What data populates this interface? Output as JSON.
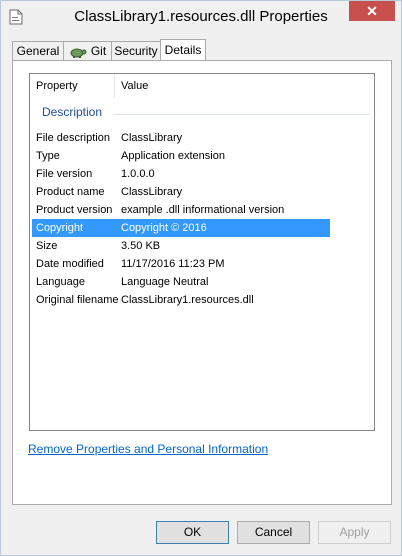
{
  "window": {
    "title": "ClassLibrary1.resources.dll Properties",
    "close_label": "✕"
  },
  "tabs": [
    {
      "label": "General"
    },
    {
      "label": "Git"
    },
    {
      "label": "Security"
    },
    {
      "label": "Details"
    }
  ],
  "details": {
    "columns": {
      "property": "Property",
      "value": "Value"
    },
    "group_label": "Description",
    "rows": [
      {
        "property": "File description",
        "value": "ClassLibrary"
      },
      {
        "property": "Type",
        "value": "Application extension"
      },
      {
        "property": "File version",
        "value": "1.0.0.0"
      },
      {
        "property": "Product name",
        "value": "ClassLibrary"
      },
      {
        "property": "Product version",
        "value": "example .dll informational version"
      },
      {
        "property": "Copyright",
        "value": "Copyright © 2016"
      },
      {
        "property": "Size",
        "value": "3.50 KB"
      },
      {
        "property": "Date modified",
        "value": "11/17/2016 11:23 PM"
      },
      {
        "property": "Language",
        "value": "Language Neutral"
      },
      {
        "property": "Original filename",
        "value": "ClassLibrary1.resources.dll"
      }
    ],
    "selected_property": "Copyright"
  },
  "remove_link": "Remove Properties and Personal Information",
  "buttons": {
    "ok": "OK",
    "cancel": "Cancel",
    "apply": "Apply"
  },
  "colors": {
    "selection": "#3399ff",
    "link": "#0066cc",
    "group": "#1e4e9a",
    "close": "#c7504c"
  }
}
